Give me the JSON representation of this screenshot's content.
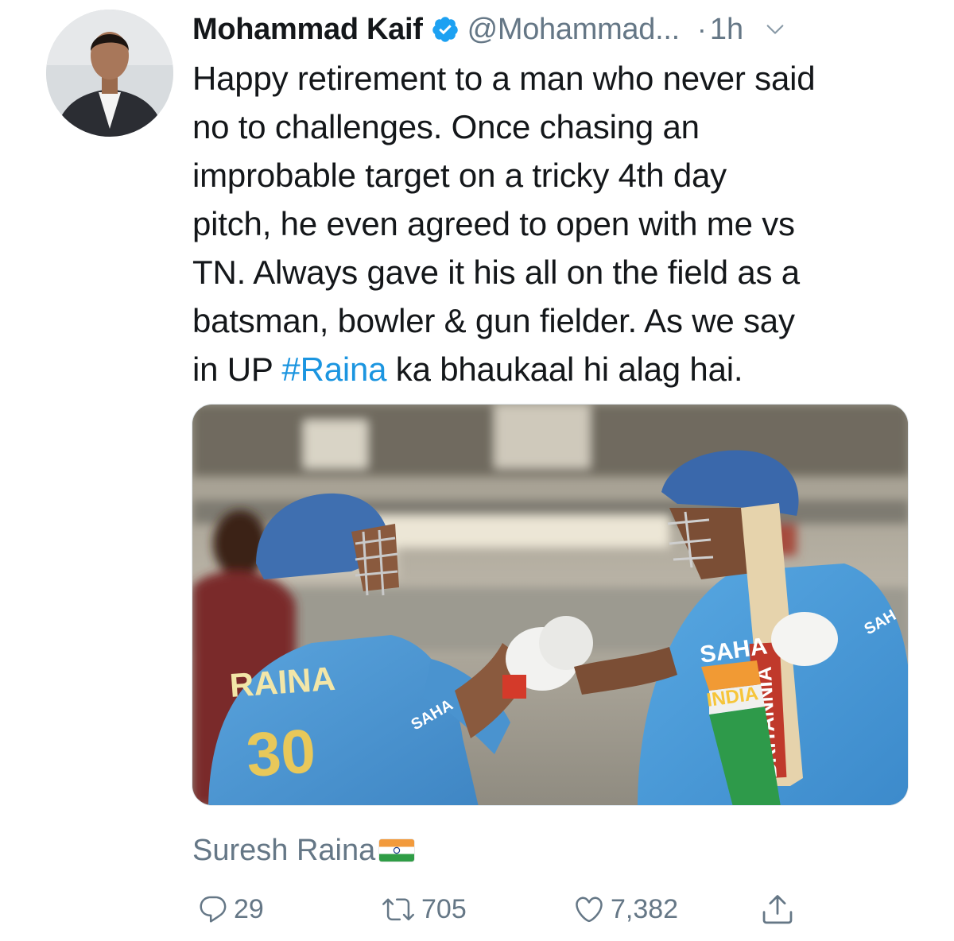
{
  "tweet": {
    "author": {
      "name": "Mohammad Kaif",
      "handle": "@Mohammad...",
      "verified": true,
      "avatar_icon": "profile-photo"
    },
    "time_separator": "·",
    "time": "1h",
    "text_lines": [
      "Happy retirement to a man who never said",
      "no to challenges. Once chasing an",
      "improbable target on a tricky 4th day",
      "pitch, he even agreed to open with me vs",
      "TN. Always gave it his all on the field as a",
      "batsman, bowler & gun fielder. As we say"
    ],
    "last_line": {
      "before": "in UP ",
      "hashtag": "#Raina",
      "after": " ka bhaukaal hi alag hai."
    },
    "media": {
      "jersey_name": "RAINA",
      "jersey_number": "30",
      "sponsor_left": "SAHA",
      "sponsor_right": "SAHA",
      "sponsor_shoulder": "SAH",
      "bat_brand": "BRITANNIA",
      "chest_text": "INDIA"
    },
    "tagged_user": "Suresh Raina",
    "tagged_flag_icon": "india-flag-icon",
    "actions": {
      "replies": "29",
      "retweets": "705",
      "likes": "7,382"
    }
  },
  "colors": {
    "link": "#1b95e0",
    "secondary": "#657786",
    "primary": "#14171a",
    "verified": "#1da1f2"
  }
}
